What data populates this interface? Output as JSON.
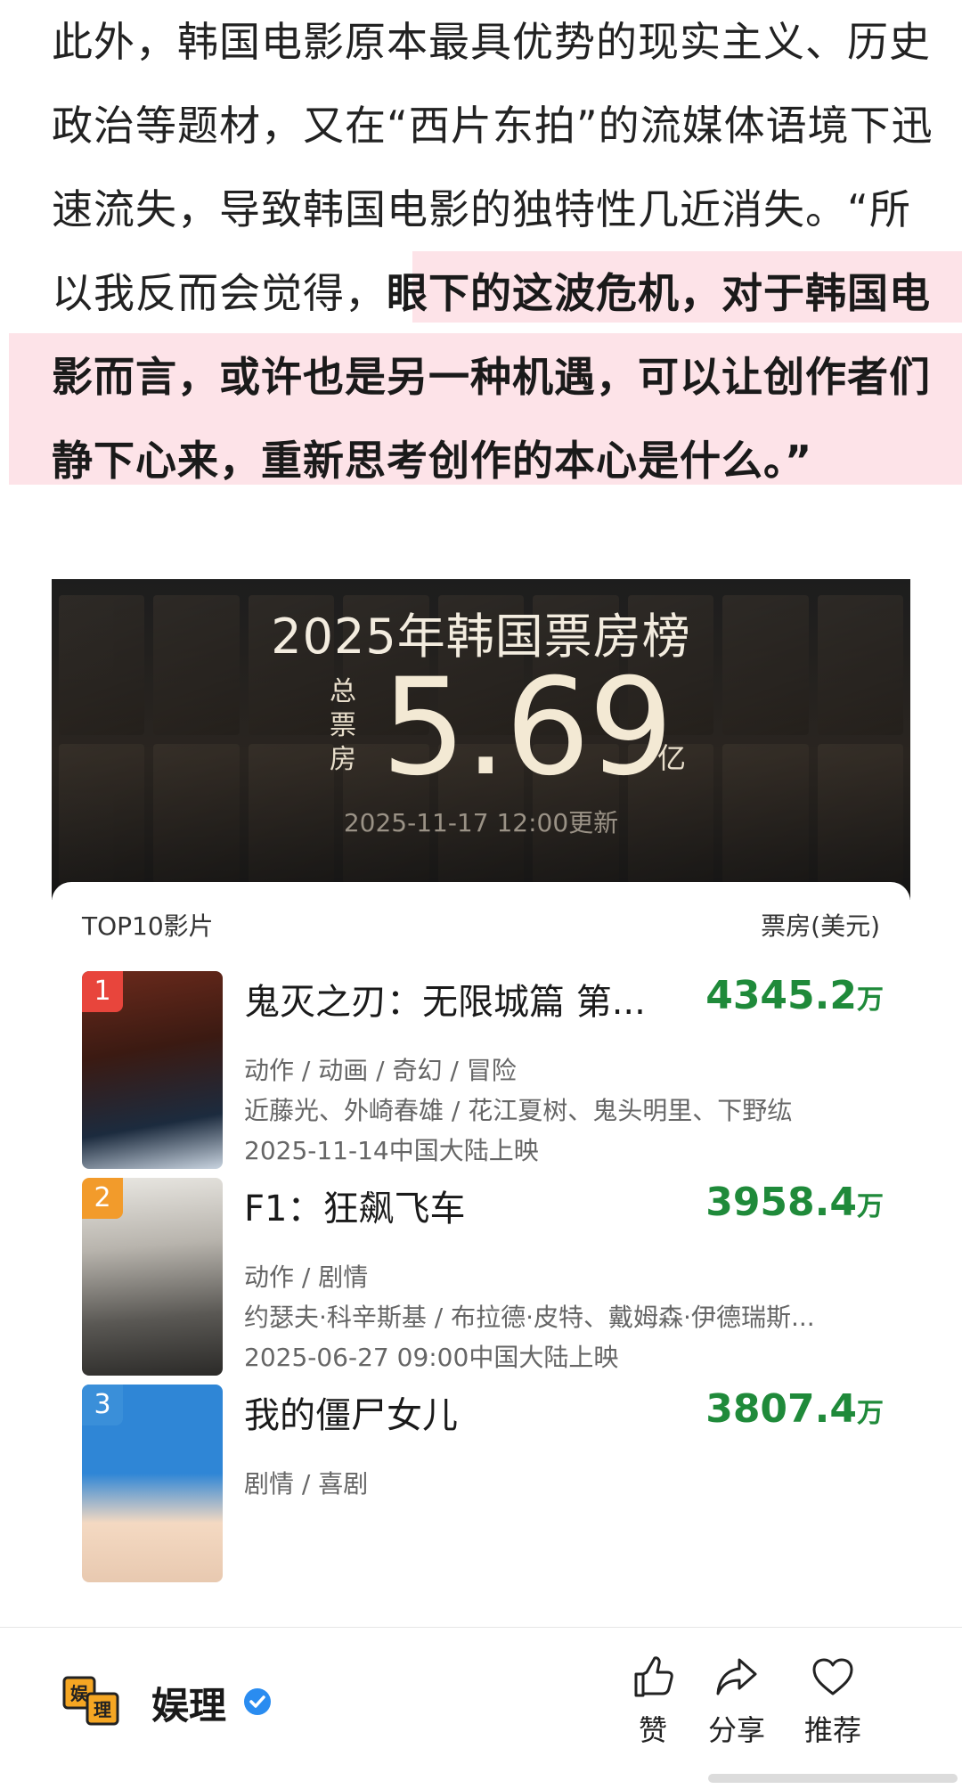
{
  "article": {
    "line1": "此外，韩国电影原本最具优势的现实主义、历史",
    "line2": "政治等题材，又在“西片东拍”的流媒体语境下迅",
    "line3": "速流失，导致韩国电影的独特性几近消失。“所",
    "line4_plain": "以我反而会觉得，",
    "line4_bold": "眼下的这波危机，对于韩国电",
    "line5_bold": "影而言，或许也是另一种机遇，可以让创作者们",
    "line6_bold": "静下心来，重新思考创作的本心是什么。”",
    "highlight_color": "#fde3e8"
  },
  "banner": {
    "title": "2025年韩国票房榜",
    "total_label": "总票房",
    "total_value": "5.69",
    "total_unit": "亿",
    "update_time": "2025-11-17 12:00更新"
  },
  "list": {
    "header_left": "TOP10影片",
    "header_right": "票房(美元)",
    "gross_color": "#1f8a3a",
    "movies": [
      {
        "rank": "1",
        "rank_color": "#e8453c",
        "title": "鬼灭之刃：无限城篇 第...",
        "gross": "4345.2",
        "gross_unit": "万",
        "genre": "动作 / 动画 / 奇幻 / 冒险",
        "cast": "近藤光、外崎春雄 / 花江夏树、鬼头明里、下野纮",
        "date": "2025-11-14中国大陆上映"
      },
      {
        "rank": "2",
        "rank_color": "#f29b2b",
        "title": "F1：狂飙飞车",
        "gross": "3958.4",
        "gross_unit": "万",
        "genre": "动作 / 剧情",
        "cast": "约瑟夫·科辛斯基 / 布拉德·皮特、戴姆森·伊德瑞斯...",
        "date": "2025-06-27 09:00中国大陆上映"
      },
      {
        "rank": "3",
        "rank_color": "#3a8fd9",
        "title": "我的僵尸女儿",
        "gross": "3807.4",
        "gross_unit": "万",
        "genre": "剧情 / 喜剧",
        "cast": "",
        "date": ""
      }
    ]
  },
  "bottom": {
    "account": "娱理",
    "logo_text": "娱理",
    "like": "赞",
    "share": "分享",
    "recommend": "推荐"
  }
}
